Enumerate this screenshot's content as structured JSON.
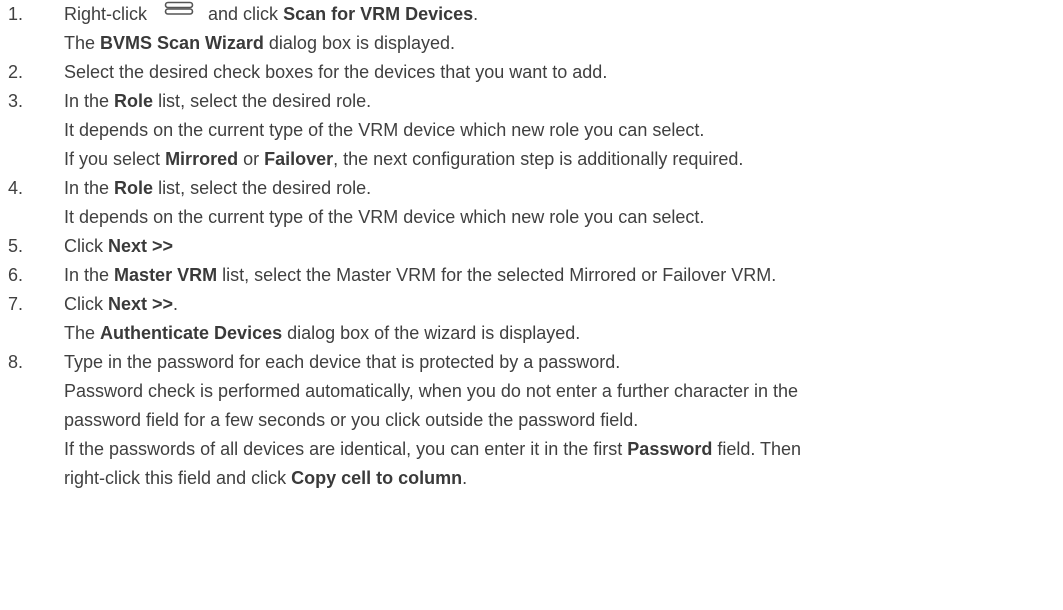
{
  "steps": [
    {
      "num": "1.",
      "lines": [
        [
          "Right-click ",
          {
            "icon": "storage-device-icon"
          },
          "and click ",
          {
            "b": "Scan for VRM Devices"
          },
          "."
        ],
        [
          "The ",
          {
            "b": "BVMS Scan Wizard"
          },
          " dialog box is displayed."
        ]
      ]
    },
    {
      "num": "2.",
      "lines": [
        [
          "Select the desired check boxes for the devices that you want to add."
        ]
      ]
    },
    {
      "num": "3.",
      "lines": [
        [
          "In the ",
          {
            "b": "Role"
          },
          " list, select the desired role."
        ],
        [
          "It depends on the current type of the VRM device which new role you can select."
        ],
        [
          "If you select ",
          {
            "b": "Mirrored"
          },
          " or ",
          {
            "b": "Failover"
          },
          ", the next configuration step is additionally required."
        ]
      ]
    },
    {
      "num": "4.",
      "lines": [
        [
          "In the ",
          {
            "b": "Role"
          },
          " list, select the desired role."
        ],
        [
          "It depends on the current type of the VRM device which new role you can select."
        ]
      ]
    },
    {
      "num": "5.",
      "lines": [
        [
          "Click ",
          {
            "b": "Next >>"
          }
        ]
      ]
    },
    {
      "num": "6.",
      "lines": [
        [
          "In the ",
          {
            "b": "Master VRM"
          },
          " list, select the Master VRM for the selected Mirrored or Failover VRM."
        ]
      ]
    },
    {
      "num": "7.",
      "lines": [
        [
          "Click ",
          {
            "b": "Next >>"
          },
          "."
        ],
        [
          "The ",
          {
            "b": "Authenticate Devices"
          },
          " dialog box of the wizard is displayed."
        ]
      ]
    },
    {
      "num": "8.",
      "lines": [
        [
          "Type in the password for each device that is protected by a password."
        ],
        [
          "Password check is performed automatically, when you do not enter a further character in the"
        ],
        [
          "password field for a few seconds or you click outside the password field."
        ],
        [
          "If the passwords of all devices are identical, you can enter it in the first ",
          {
            "b": "Password"
          },
          " field. Then"
        ],
        [
          "right-click this field and click ",
          {
            "b": "Copy cell to column"
          },
          "."
        ]
      ]
    }
  ]
}
